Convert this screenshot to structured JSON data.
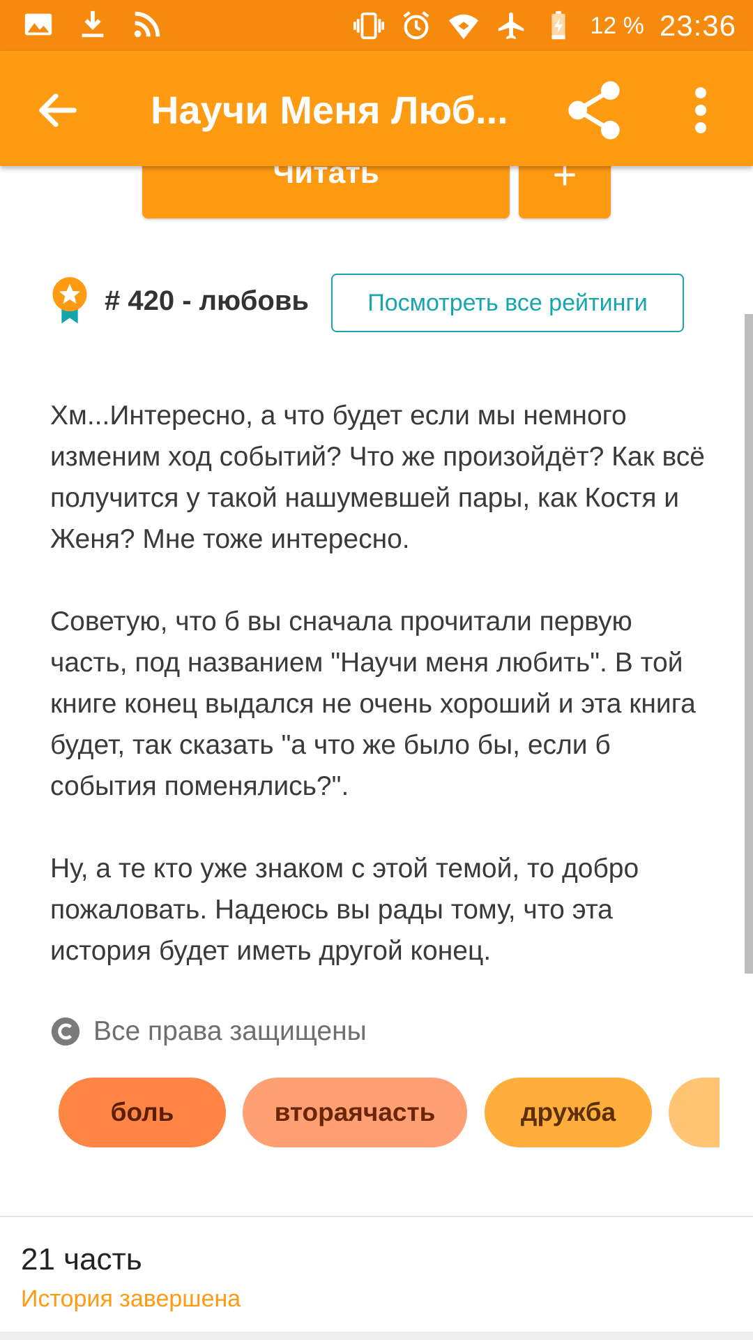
{
  "status_bar": {
    "battery": "12 %",
    "time": "23:36",
    "icons": [
      "image-icon",
      "download-icon",
      "rss-icon",
      "vibrate-icon",
      "alarm-icon",
      "wifi-icon",
      "airplane-icon",
      "battery-charging-icon"
    ]
  },
  "app_bar": {
    "title": "Научи Меня Люб...",
    "icons": [
      "back-arrow-icon",
      "share-icon",
      "more-vert-icon"
    ]
  },
  "actions": {
    "read_label": "Читать",
    "add_label": "+"
  },
  "ranking": {
    "text": "# 420 - любовь",
    "button_label": "Посмотреть все рейтинги"
  },
  "description": {
    "paragraphs": [
      "Хм...Интересно, а что будет если мы немного изменим ход событий? Что же произойдёт? Как всё получится у такой нашумевшей пары, как Костя и Женя? Мне тоже интересно.",
      "Советую, что б вы сначала прочитали первую часть, под названием \"Научи меня любить\". В той книге конец выдался не очень хороший и эта книга будет, так сказать \"а что же было бы, если б события поменялись?\".",
      "Ну, а те кто уже знаком с этой темой, то добро пожаловать. Надеюсь вы рады тому, что эта история будет иметь другой конец."
    ]
  },
  "copyright": {
    "text": "Все права защищены"
  },
  "tags": [
    "боль",
    "втораячасть",
    "дружба",
    ""
  ],
  "parts": {
    "count": "21 часть",
    "status": "История завершена"
  },
  "colors": {
    "status_bar": "#f58a0c",
    "app_bar": "#ff9a13",
    "accent_teal": "#16a5ad",
    "status_text": "#ff9a13"
  }
}
